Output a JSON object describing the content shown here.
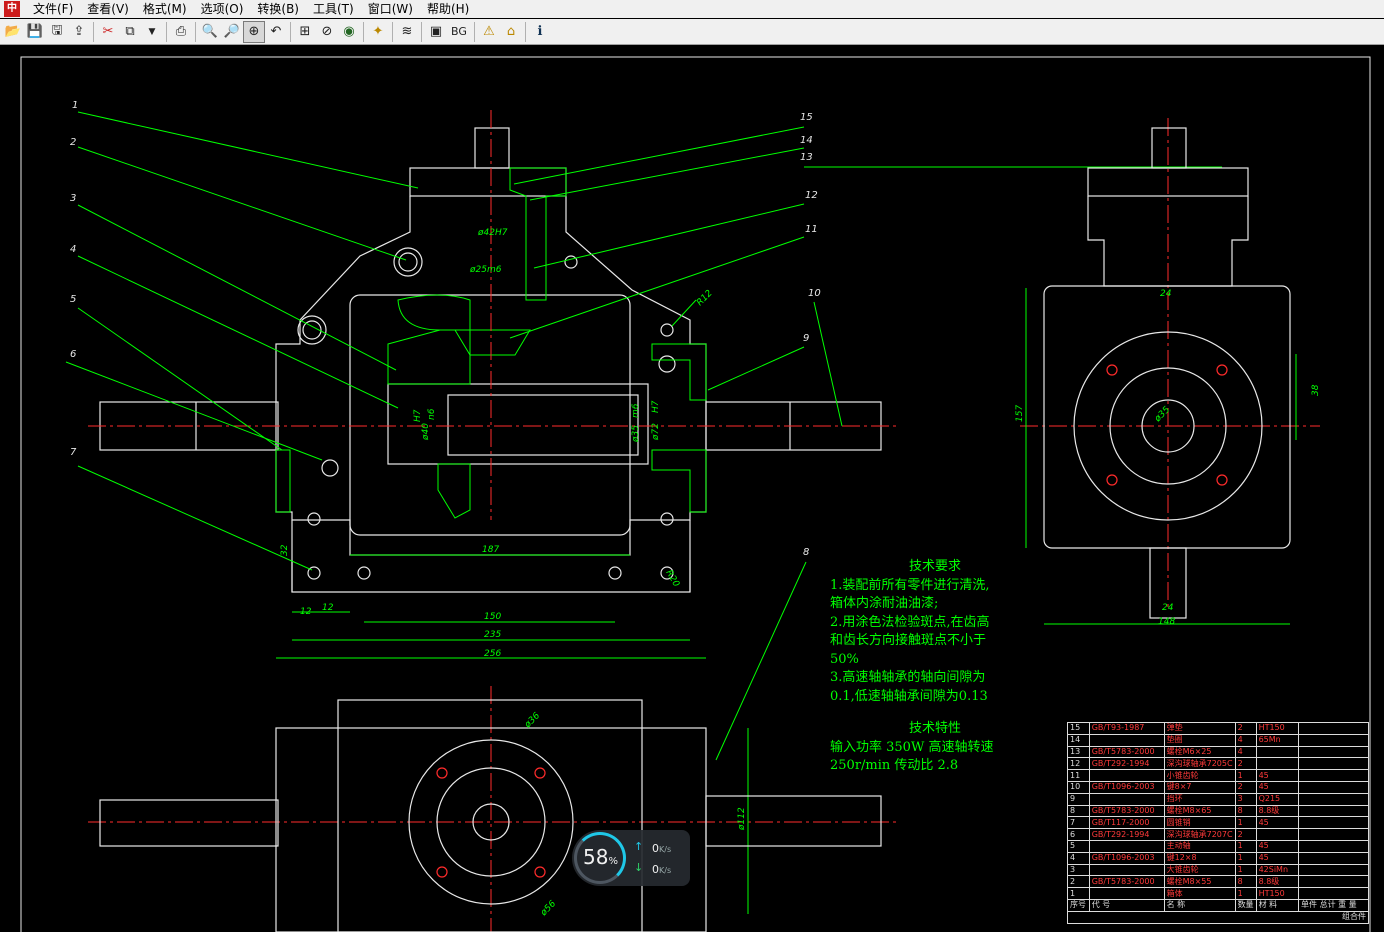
{
  "menubar": {
    "items": [
      "文件(F)",
      "查看(V)",
      "格式(M)",
      "选项(O)",
      "转换(B)",
      "工具(T)",
      "窗口(W)",
      "帮助(H)"
    ]
  },
  "toolbar": {
    "bg_label": "BG",
    "icons": [
      "open-icon",
      "save-icon",
      "save-as-icon",
      "export-icon",
      "cut-icon",
      "copy-icon",
      "dropdown-icon",
      "print-icon",
      "zoom-out-icon",
      "zoom-in-icon",
      "zoom-window-icon",
      "zoom-prev-icon",
      "zoom-all-icon",
      "zoom-realtime-icon",
      "view-icon",
      "pan-icon",
      "layers-icon",
      "background-icon",
      "bg-toggle",
      "measure-icon",
      "home-icon",
      "about-icon"
    ]
  },
  "drawing": {
    "part_labels": [
      "1",
      "2",
      "3",
      "4",
      "5",
      "6",
      "7",
      "8",
      "9",
      "10",
      "11",
      "12",
      "13",
      "14",
      "15"
    ],
    "dims_front": [
      "ø42H7",
      "ø25m6",
      "R12",
      "H7",
      "n6",
      "ø40",
      "ø35",
      "m6",
      "ø72",
      "H7",
      "187",
      "12",
      "150",
      "235",
      "256",
      "32",
      "12",
      "R20"
    ],
    "dims_side": [
      "24",
      "157",
      "38",
      "ø35",
      "24",
      "148"
    ],
    "dims_top": [
      "ø36",
      "ø112",
      "ø56"
    ]
  },
  "tech_requirements": {
    "title": "技术要求",
    "lines": [
      "1.装配前所有零件进行清洗,",
      "箱体内涂耐油油漆;",
      "2.用涂色法检验斑点,在齿高",
      "和齿长方向接触斑点不小于",
      "50%",
      "3.高速轴轴承的轴向间隙为",
      "0.1,低速轴轴承间隙为0.13"
    ]
  },
  "tech_specs": {
    "title": "技术特性",
    "lines": [
      "输入功率 350W 高速轴转速",
      "250r/min  传动比 2.8"
    ]
  },
  "parts_table": {
    "rows": [
      [
        "15",
        "GB/T93-1987",
        "弹垫",
        "2",
        "HT150",
        ""
      ],
      [
        "14",
        "",
        "垫圈",
        "4",
        "65Mn",
        ""
      ],
      [
        "13",
        "GB/T5783-2000",
        "螺栓M6×25",
        "4",
        "",
        ""
      ],
      [
        "12",
        "GB/T292-1994",
        "深沟球轴承7205C",
        "2",
        "",
        ""
      ],
      [
        "11",
        "",
        "小锥齿轮",
        "1",
        "45",
        ""
      ],
      [
        "10",
        "GB/T1096-2003",
        "键8×7",
        "2",
        "45",
        ""
      ],
      [
        "9",
        "",
        "挡环",
        "3",
        "Q215",
        ""
      ],
      [
        "8",
        "GB/T5783-2000",
        "螺栓M8×65",
        "8",
        "8.8级",
        ""
      ],
      [
        "7",
        "GB/T117-2000",
        "圆锥销",
        "1",
        "45",
        ""
      ],
      [
        "6",
        "GB/T292-1994",
        "深沟球轴承7207C",
        "2",
        "",
        ""
      ],
      [
        "5",
        "",
        "主动轴",
        "1",
        "45",
        ""
      ],
      [
        "4",
        "GB/T1096-2003",
        "键12×8",
        "1",
        "45",
        ""
      ],
      [
        "3",
        "",
        "大锥齿轮",
        "1",
        "42SiMn",
        ""
      ],
      [
        "2",
        "GB/T5783-2000",
        "螺栓M8×55",
        "8",
        "8.8级",
        ""
      ],
      [
        "1",
        "",
        "箱体",
        "1",
        "HT150",
        ""
      ]
    ],
    "footer": [
      "序号",
      "代    号",
      "名    称",
      "数量",
      "材    料",
      "单件 总计  重  量"
    ],
    "extra_label": "组合件"
  },
  "net_widget": {
    "percent": "58",
    "percent_sign": "%",
    "up_value": "0",
    "up_unit": "K/s",
    "down_value": "0",
    "down_unit": "K/s"
  }
}
